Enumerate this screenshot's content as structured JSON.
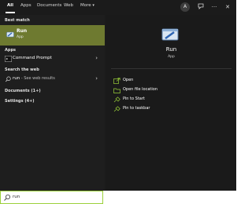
{
  "tabs": [
    {
      "label": "All"
    },
    {
      "label": "Apps"
    },
    {
      "label": "Documents"
    },
    {
      "label": "Web"
    },
    {
      "label": "More"
    }
  ],
  "topbar": {
    "account_initial": "A",
    "more_chevron": "▾",
    "ellipsis": "···",
    "close": "✕"
  },
  "left": {
    "best_match_title": "Best match",
    "best": {
      "name": "Run",
      "subtitle": "App"
    },
    "apps_title": "Apps",
    "apps": [
      {
        "label": "Command Prompt"
      }
    ],
    "search_web_title": "Search the web",
    "web_results": [
      {
        "query": "run",
        "suffix": " - See web results"
      }
    ],
    "documents": "Documents (1+)",
    "settings": "Settings (4+)",
    "chevron": "›"
  },
  "right": {
    "title": "Run",
    "subtitle": "App",
    "actions": [
      {
        "label": "Open"
      },
      {
        "label": "Open file location"
      },
      {
        "label": "Pin to Start"
      },
      {
        "label": "Pin to taskbar"
      }
    ]
  },
  "search": {
    "value": "run"
  },
  "colors": {
    "accent": "#9bd13a",
    "highlight": "#6e7a30",
    "panel": "#1b1b1b"
  }
}
